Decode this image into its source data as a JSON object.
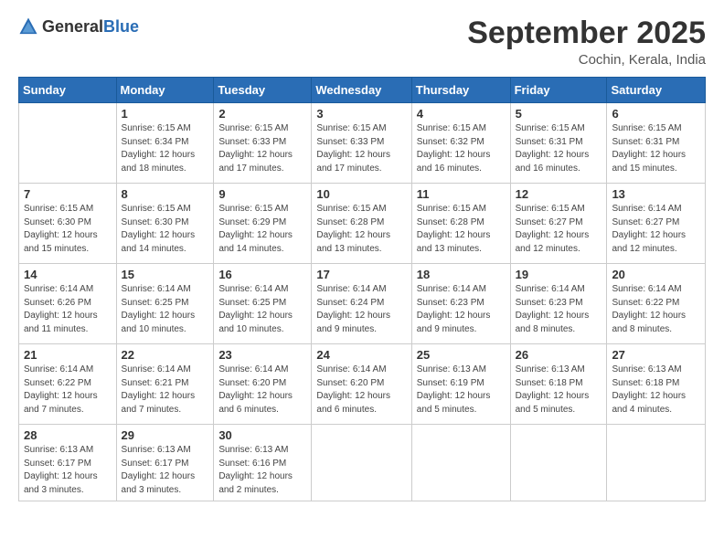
{
  "header": {
    "logo_general": "General",
    "logo_blue": "Blue",
    "month_title": "September 2025",
    "subtitle": "Cochin, Kerala, India"
  },
  "weekdays": [
    "Sunday",
    "Monday",
    "Tuesday",
    "Wednesday",
    "Thursday",
    "Friday",
    "Saturday"
  ],
  "weeks": [
    [
      {
        "day": "",
        "info": ""
      },
      {
        "day": "1",
        "info": "Sunrise: 6:15 AM\nSunset: 6:34 PM\nDaylight: 12 hours\nand 18 minutes."
      },
      {
        "day": "2",
        "info": "Sunrise: 6:15 AM\nSunset: 6:33 PM\nDaylight: 12 hours\nand 17 minutes."
      },
      {
        "day": "3",
        "info": "Sunrise: 6:15 AM\nSunset: 6:33 PM\nDaylight: 12 hours\nand 17 minutes."
      },
      {
        "day": "4",
        "info": "Sunrise: 6:15 AM\nSunset: 6:32 PM\nDaylight: 12 hours\nand 16 minutes."
      },
      {
        "day": "5",
        "info": "Sunrise: 6:15 AM\nSunset: 6:31 PM\nDaylight: 12 hours\nand 16 minutes."
      },
      {
        "day": "6",
        "info": "Sunrise: 6:15 AM\nSunset: 6:31 PM\nDaylight: 12 hours\nand 15 minutes."
      }
    ],
    [
      {
        "day": "7",
        "info": "Sunrise: 6:15 AM\nSunset: 6:30 PM\nDaylight: 12 hours\nand 15 minutes."
      },
      {
        "day": "8",
        "info": "Sunrise: 6:15 AM\nSunset: 6:30 PM\nDaylight: 12 hours\nand 14 minutes."
      },
      {
        "day": "9",
        "info": "Sunrise: 6:15 AM\nSunset: 6:29 PM\nDaylight: 12 hours\nand 14 minutes."
      },
      {
        "day": "10",
        "info": "Sunrise: 6:15 AM\nSunset: 6:28 PM\nDaylight: 12 hours\nand 13 minutes."
      },
      {
        "day": "11",
        "info": "Sunrise: 6:15 AM\nSunset: 6:28 PM\nDaylight: 12 hours\nand 13 minutes."
      },
      {
        "day": "12",
        "info": "Sunrise: 6:15 AM\nSunset: 6:27 PM\nDaylight: 12 hours\nand 12 minutes."
      },
      {
        "day": "13",
        "info": "Sunrise: 6:14 AM\nSunset: 6:27 PM\nDaylight: 12 hours\nand 12 minutes."
      }
    ],
    [
      {
        "day": "14",
        "info": "Sunrise: 6:14 AM\nSunset: 6:26 PM\nDaylight: 12 hours\nand 11 minutes."
      },
      {
        "day": "15",
        "info": "Sunrise: 6:14 AM\nSunset: 6:25 PM\nDaylight: 12 hours\nand 10 minutes."
      },
      {
        "day": "16",
        "info": "Sunrise: 6:14 AM\nSunset: 6:25 PM\nDaylight: 12 hours\nand 10 minutes."
      },
      {
        "day": "17",
        "info": "Sunrise: 6:14 AM\nSunset: 6:24 PM\nDaylight: 12 hours\nand 9 minutes."
      },
      {
        "day": "18",
        "info": "Sunrise: 6:14 AM\nSunset: 6:23 PM\nDaylight: 12 hours\nand 9 minutes."
      },
      {
        "day": "19",
        "info": "Sunrise: 6:14 AM\nSunset: 6:23 PM\nDaylight: 12 hours\nand 8 minutes."
      },
      {
        "day": "20",
        "info": "Sunrise: 6:14 AM\nSunset: 6:22 PM\nDaylight: 12 hours\nand 8 minutes."
      }
    ],
    [
      {
        "day": "21",
        "info": "Sunrise: 6:14 AM\nSunset: 6:22 PM\nDaylight: 12 hours\nand 7 minutes."
      },
      {
        "day": "22",
        "info": "Sunrise: 6:14 AM\nSunset: 6:21 PM\nDaylight: 12 hours\nand 7 minutes."
      },
      {
        "day": "23",
        "info": "Sunrise: 6:14 AM\nSunset: 6:20 PM\nDaylight: 12 hours\nand 6 minutes."
      },
      {
        "day": "24",
        "info": "Sunrise: 6:14 AM\nSunset: 6:20 PM\nDaylight: 12 hours\nand 6 minutes."
      },
      {
        "day": "25",
        "info": "Sunrise: 6:13 AM\nSunset: 6:19 PM\nDaylight: 12 hours\nand 5 minutes."
      },
      {
        "day": "26",
        "info": "Sunrise: 6:13 AM\nSunset: 6:18 PM\nDaylight: 12 hours\nand 5 minutes."
      },
      {
        "day": "27",
        "info": "Sunrise: 6:13 AM\nSunset: 6:18 PM\nDaylight: 12 hours\nand 4 minutes."
      }
    ],
    [
      {
        "day": "28",
        "info": "Sunrise: 6:13 AM\nSunset: 6:17 PM\nDaylight: 12 hours\nand 3 minutes."
      },
      {
        "day": "29",
        "info": "Sunrise: 6:13 AM\nSunset: 6:17 PM\nDaylight: 12 hours\nand 3 minutes."
      },
      {
        "day": "30",
        "info": "Sunrise: 6:13 AM\nSunset: 6:16 PM\nDaylight: 12 hours\nand 2 minutes."
      },
      {
        "day": "",
        "info": ""
      },
      {
        "day": "",
        "info": ""
      },
      {
        "day": "",
        "info": ""
      },
      {
        "day": "",
        "info": ""
      }
    ]
  ]
}
